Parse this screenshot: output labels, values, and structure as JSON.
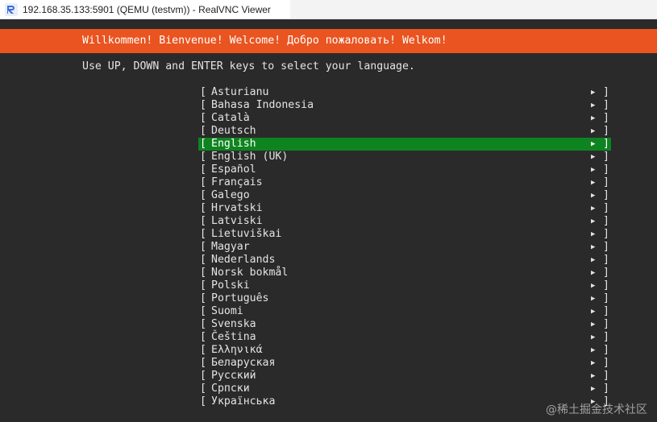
{
  "window": {
    "title": "192.168.35.133:5901 (QEMU (testvm)) - RealVNC Viewer",
    "icon": "realvnc-logo-icon"
  },
  "installer": {
    "banner": "Willkommen! Bienvenue! Welcome! Добро пожаловать! Welkom!",
    "instructions": "Use UP, DOWN and ENTER keys to select your language.",
    "open_bracket": "[",
    "close_bracket": "]",
    "arrow": "▶",
    "selected_index": 4,
    "languages": [
      {
        "label": "Asturianu"
      },
      {
        "label": "Bahasa Indonesia"
      },
      {
        "label": "Català"
      },
      {
        "label": "Deutsch"
      },
      {
        "label": "English"
      },
      {
        "label": "English (UK)"
      },
      {
        "label": "Español"
      },
      {
        "label": "Français"
      },
      {
        "label": "Galego"
      },
      {
        "label": "Hrvatski"
      },
      {
        "label": "Latviski"
      },
      {
        "label": "Lietuviškai"
      },
      {
        "label": "Magyar"
      },
      {
        "label": "Nederlands"
      },
      {
        "label": "Norsk bokmål"
      },
      {
        "label": "Polski"
      },
      {
        "label": "Português"
      },
      {
        "label": "Suomi"
      },
      {
        "label": "Svenska"
      },
      {
        "label": "Čeština"
      },
      {
        "label": "Ελληνικά"
      },
      {
        "label": "Беларуская"
      },
      {
        "label": "Русский"
      },
      {
        "label": "Српски"
      },
      {
        "label": "Українська"
      }
    ]
  },
  "watermark": "@稀土掘金技术社区",
  "colors": {
    "banner": "#e95420",
    "selection": "#0e8420",
    "terminal_bg": "#2a2a2a",
    "terminal_fg": "#e4e4e4"
  }
}
